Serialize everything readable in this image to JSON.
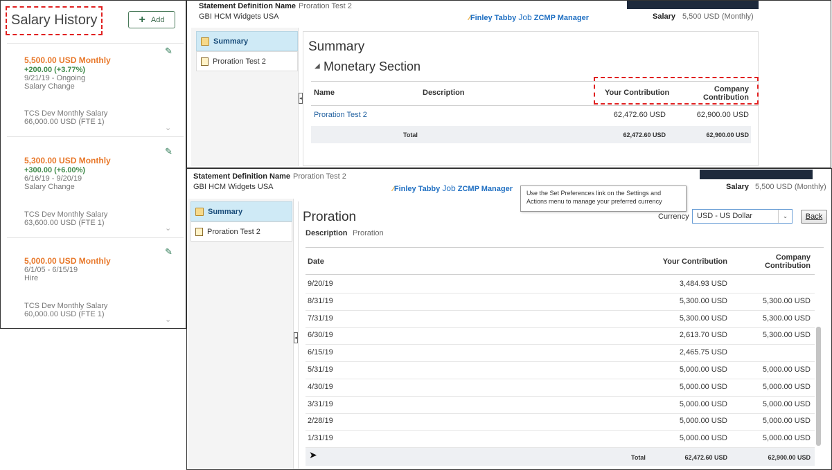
{
  "salary_history": {
    "title": "Salary History",
    "add_label": "Add",
    "entries": [
      {
        "amount": "5,500.00 USD Monthly",
        "change": "+200.00 (+3.77%)",
        "dates": "9/21/19 - Ongoing",
        "reason": "Salary Change",
        "plan": "TCS Dev Monthly Salary",
        "annual": "66,000.00 USD (FTE 1)"
      },
      {
        "amount": "5,300.00 USD Monthly",
        "change": "+300.00 (+6.00%)",
        "dates": "6/16/19 - 9/20/19",
        "reason": "Salary Change",
        "plan": "TCS Dev Monthly Salary",
        "annual": "63,600.00 USD (FTE 1)"
      },
      {
        "amount": "5,000.00 USD Monthly",
        "dates": "6/1/05 - 6/15/19",
        "reason": "Hire",
        "plan": "TCS Dev Monthly Salary",
        "annual": "60,000.00 USD (FTE 1)"
      }
    ]
  },
  "header": {
    "stmt_def_label": "Statement Definition Name",
    "stmt_def_value": "Proration Test 2",
    "company": "GBI HCM Widgets USA",
    "brand_person": "Finley Tabby",
    "brand_job": "Job",
    "brand_title": "ZCMP Manager",
    "salary_label": "Salary",
    "salary_value": "5,500 USD (Monthly)"
  },
  "nav": {
    "summary": "Summary",
    "proration": "Proration Test 2"
  },
  "summary": {
    "title": "Summary",
    "section": "Monetary Section",
    "columns": {
      "name": "Name",
      "description": "Description",
      "your": "Your Contribution",
      "company_l1": "Company",
      "company_l2": "Contribution"
    },
    "row": {
      "name": "Proration Test 2",
      "your": "62,472.60 USD",
      "company": "62,900.00 USD"
    },
    "total": {
      "label": "Total",
      "your": "62,472.60 USD",
      "company": "62,900.00 USD"
    }
  },
  "proration": {
    "title": "Proration",
    "description_label": "Description",
    "description_value": "Proration",
    "currency_label": "Currency",
    "currency_value": "USD - US Dollar",
    "back_label": "Back",
    "tooltip": "Use the Set Preferences link on the Settings and Actions menu to manage your preferred currency",
    "columns": {
      "date": "Date",
      "your": "Your Contribution",
      "company_l1": "Company",
      "company_l2": "Contribution"
    },
    "rows": [
      {
        "date": "9/20/19",
        "your": "3,484.93 USD",
        "company": ""
      },
      {
        "date": "8/31/19",
        "your": "5,300.00 USD",
        "company": "5,300.00 USD"
      },
      {
        "date": "7/31/19",
        "your": "5,300.00 USD",
        "company": "5,300.00 USD"
      },
      {
        "date": "6/30/19",
        "your": "2,613.70 USD",
        "company": "5,300.00 USD"
      },
      {
        "date": "6/15/19",
        "your": "2,465.75 USD",
        "company": ""
      },
      {
        "date": "5/31/19",
        "your": "5,000.00 USD",
        "company": "5,000.00 USD"
      },
      {
        "date": "4/30/19",
        "your": "5,000.00 USD",
        "company": "5,000.00 USD"
      },
      {
        "date": "3/31/19",
        "your": "5,000.00 USD",
        "company": "5,000.00 USD"
      },
      {
        "date": "2/28/19",
        "your": "5,000.00 USD",
        "company": "5,000.00 USD"
      },
      {
        "date": "1/31/19",
        "your": "5,000.00 USD",
        "company": "5,000.00 USD"
      }
    ],
    "total": {
      "label": "Total",
      "your": "62,472.60 USD",
      "company": "62,900.00 USD"
    }
  }
}
